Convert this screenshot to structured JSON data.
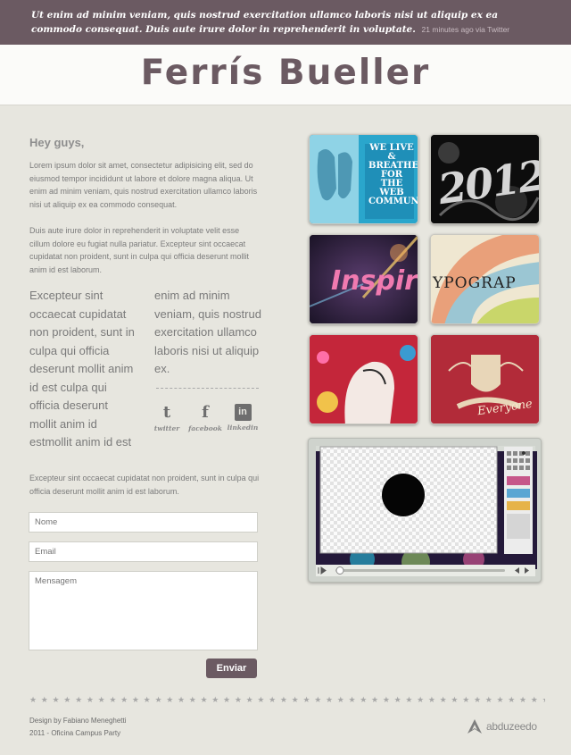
{
  "top_bar": {
    "tweet": "Ut enim ad minim veniam, quis nostrud exercitation ullamco laboris nisi ut aliquip ex ea commodo consequat. Duis aute irure dolor in reprehenderit in voluptate.",
    "tweet_meta": "21 minutes ago via Twitter"
  },
  "header": {
    "title": "Ferrís Bueller"
  },
  "content": {
    "greeting": "Hey guys,",
    "paragraph_1": "Lorem ipsum dolor sit amet, consectetur adipisicing elit, sed do eiusmod tempor incididunt ut labore et dolore magna aliqua. Ut enim ad minim veniam, quis nostrud exercitation ullamco laboris nisi ut aliquip ex ea commodo consequat.",
    "paragraph_2": "Duis aute irure dolor in reprehenderit in voluptate velit esse cillum dolore eu fugiat nulla pariatur. Excepteur sint occaecat cupidatat non proident, sunt in culpa qui officia deserunt mollit anim id est laborum.",
    "big_col_1": "Excepteur sint occaecat cupidatat non proident, sunt in culpa qui officia deserunt mollit anim id est culpa qui officia deserunt mollit anim id estmollit anim id est",
    "big_col_2": "enim ad minim veniam, quis nostrud exercitation ullamco laboris nisi ut aliquip ex.",
    "paragraph_3": "Excepteur sint occaecat cupidatat non proident, sunt in culpa qui officia deserunt mollit anim id est laborum."
  },
  "social": [
    {
      "label": "twitter",
      "icon": "twitter-icon",
      "glyph": "t"
    },
    {
      "label": "facebook",
      "icon": "facebook-icon",
      "glyph": "f"
    },
    {
      "label": "linkedin",
      "icon": "linkedin-icon",
      "glyph": "in"
    }
  ],
  "form": {
    "name_placeholder": "Nome",
    "email_placeholder": "Email",
    "message_placeholder": "Mensagem",
    "submit_label": "Enviar"
  },
  "portfolio": {
    "thumb_1_text": "WE LIVE & BREATHE FOR THE WEB COMMUNITY",
    "thumb_2_text": "2012",
    "thumb_3_text": "Inspir",
    "thumb_4_text": "YPOGRAP",
    "thumb_6_text": "Everyone"
  },
  "footer": {
    "credit_line_1": "Design by Fabiano Meneghetti",
    "credit_line_2": "2011 - Oficina Campus Party",
    "brand": "abduzeedo"
  },
  "colors": {
    "accent": "#6b5a62",
    "background": "#e7e6df"
  }
}
